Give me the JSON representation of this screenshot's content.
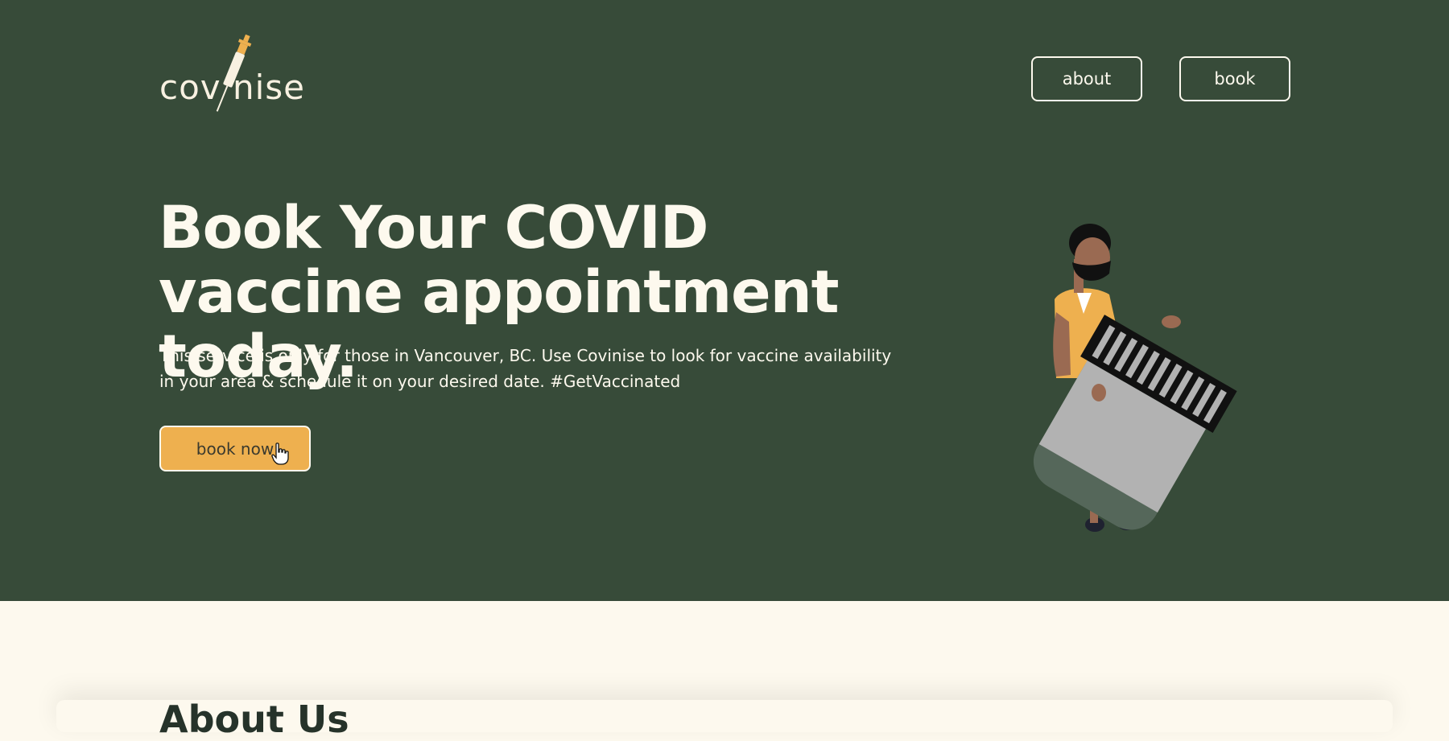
{
  "header": {
    "logo_text": "cov nise",
    "nav": [
      {
        "label": "about"
      },
      {
        "label": "book"
      }
    ]
  },
  "hero": {
    "headline": "Book Your COVID vaccine appointment today.",
    "subtext": "This service is only for those in Vancouver, BC. Use Covinise to look for vaccine availability in your area & schedule it on your desired date. #GetVaccinated",
    "cta_label": "book now"
  },
  "about": {
    "title": "About Us"
  },
  "colors": {
    "hero_bg": "#374b39",
    "accent": "#eeb04f",
    "cream": "#fdf9ee"
  }
}
